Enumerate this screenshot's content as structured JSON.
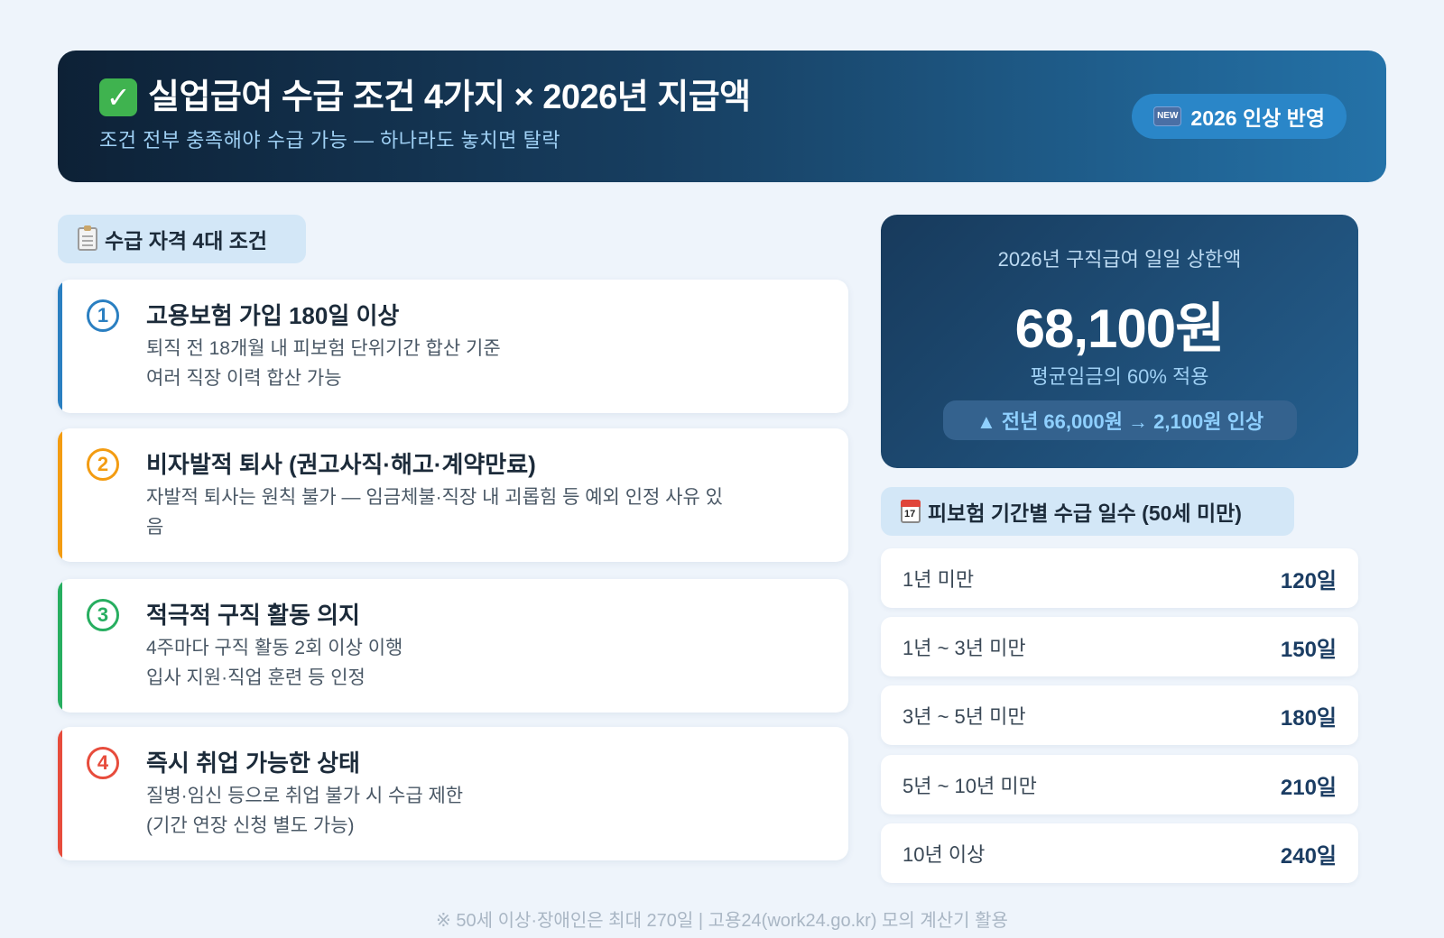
{
  "header": {
    "check_icon": "✓",
    "title": "실업급여 수급 조건 4가지 × 2026년 지급액",
    "subtitle": "조건 전부 충족해야 수급 가능 — 하나라도 놓치면 탈락",
    "badge_icon": "NEW",
    "badge": "2026 인상 반영"
  },
  "conditions_section": {
    "title": "수급 자격 4대 조건",
    "items": [
      {
        "num": "1",
        "color": "#2a7fc1",
        "title": "고용보험 가입 180일 이상",
        "desc": "퇴직 전 18개월 내 피보험 단위기간 합산 기준\n여러 직장 이력 합산 가능"
      },
      {
        "num": "2",
        "color": "#f39c12",
        "title": "비자발적 퇴사 (권고사직·해고·계약만료)",
        "desc": "자발적 퇴사는 원칙 불가 — 임금체불·직장 내 괴롭힘 등 예외 인정 사유 있\n음"
      },
      {
        "num": "3",
        "color": "#27ae60",
        "title": "적극적 구직 활동 의지",
        "desc": "4주마다 구직 활동 2회 이상 이행\n입사 지원·직업 훈련 등 인정"
      },
      {
        "num": "4",
        "color": "#e74c3c",
        "title": "즉시 취업 가능한 상태",
        "desc": "질병·임신 등으로 취업 불가 시 수급 제한\n(기간 연장 신청 별도 가능)"
      }
    ]
  },
  "max_benefit": {
    "label": "2026년 구직급여 일일 상한액",
    "amount": "68,100원",
    "note": "평균임금의 60% 적용",
    "change": "▲ 전년 66,000원 → 2,100원 인상"
  },
  "days_section": {
    "title": "피보험 기간별 수급 일수 (50세 미만)",
    "rows": [
      {
        "label": "1년 미만",
        "value": "120일"
      },
      {
        "label": "1년 ~ 3년 미만",
        "value": "150일"
      },
      {
        "label": "3년 ~ 5년 미만",
        "value": "180일"
      },
      {
        "label": "5년 ~ 10년 미만",
        "value": "210일"
      },
      {
        "label": "10년 이상",
        "value": "240일"
      }
    ]
  },
  "footnote": "※ 50세 이상·장애인은 최대 270일 | 고용24(work24.go.kr) 모의 계산기 활용"
}
